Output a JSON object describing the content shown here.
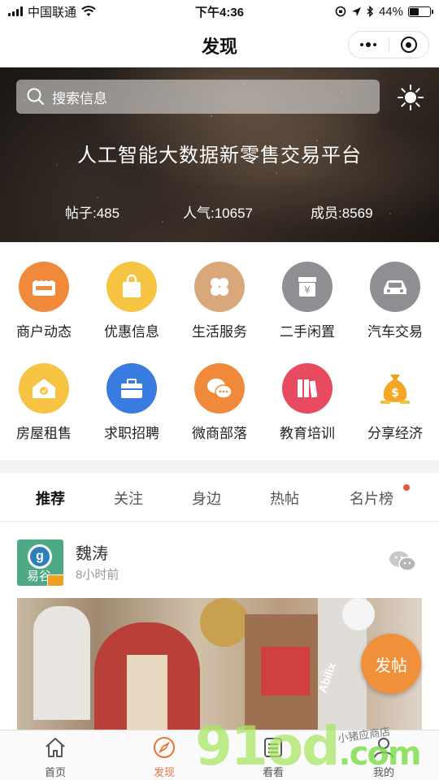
{
  "status_bar": {
    "carrier": "中国联通",
    "time": "下午4:36",
    "battery": "44%",
    "battery_level": 0.44
  },
  "nav": {
    "title": "发现"
  },
  "hero": {
    "search_placeholder": "搜索信息",
    "title": "人工智能大数据新零售交易平台",
    "stats": {
      "posts": "帖子:485",
      "popularity": "人气:10657",
      "members": "成员:8569"
    }
  },
  "categories": [
    {
      "label": "商户动态",
      "icon": "shop-icon",
      "color": "#f08a3a"
    },
    {
      "label": "优惠信息",
      "icon": "shopping-bag-icon",
      "color": "#f6c342"
    },
    {
      "label": "生活服务",
      "icon": "clover-icon",
      "color": "#d9a87a"
    },
    {
      "label": "二手闲置",
      "icon": "yen-box-icon",
      "color": "#8e8e93"
    },
    {
      "label": "汽车交易",
      "icon": "car-icon",
      "color": "#8e8e93"
    },
    {
      "label": "房屋租售",
      "icon": "house-icon",
      "color": "#f6c342"
    },
    {
      "label": "求职招聘",
      "icon": "briefcase-icon",
      "color": "#3a7be0"
    },
    {
      "label": "微商部落",
      "icon": "chat-bubbles-icon",
      "color": "#f08a3a"
    },
    {
      "label": "教育培训",
      "icon": "books-icon",
      "color": "#e84a5f"
    },
    {
      "label": "分享经济",
      "icon": "money-bag-icon",
      "color": "#f0a020"
    }
  ],
  "tabs": [
    {
      "label": "推荐",
      "active": true
    },
    {
      "label": "关注",
      "active": false
    },
    {
      "label": "身边",
      "active": false
    },
    {
      "label": "热帖",
      "active": false
    },
    {
      "label": "名片榜",
      "active": false,
      "dot": true
    }
  ],
  "post": {
    "author": "魏涛",
    "time": "8小时前",
    "avatar_text": "易谷",
    "avatar_letter": "g",
    "image_text": "Abilix"
  },
  "fab": {
    "label": "发帖"
  },
  "bottom_bar": [
    {
      "label": "首页",
      "icon": "home-icon",
      "active": false
    },
    {
      "label": "发现",
      "icon": "compass-icon",
      "active": true
    },
    {
      "label": "看看",
      "icon": "list-icon",
      "active": false
    },
    {
      "label": "我的",
      "icon": "user-icon",
      "active": false
    }
  ],
  "watermark": {
    "main": "91od",
    "suffix": ".com",
    "sub": "小猪应商店"
  },
  "colors": {
    "accent": "#e8743a",
    "fab": "#f0903a",
    "dot": "#e8563a"
  }
}
